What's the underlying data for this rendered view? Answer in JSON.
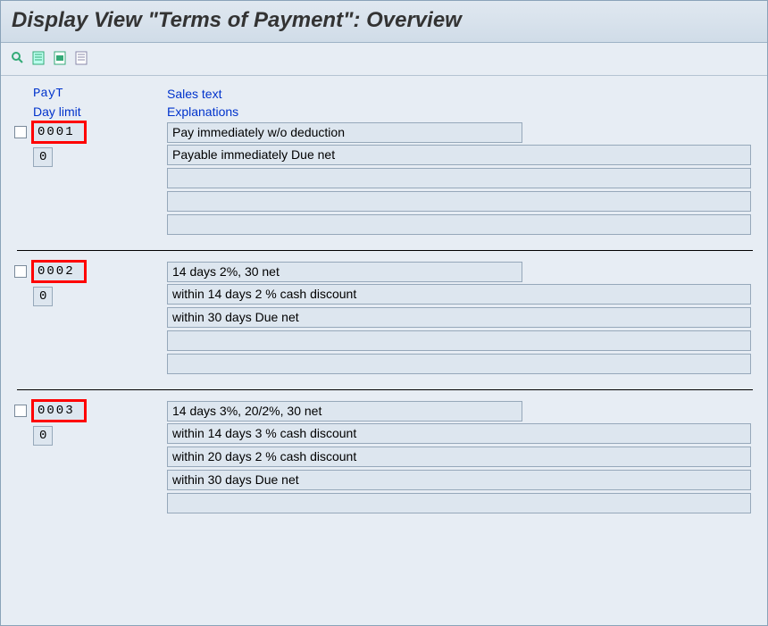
{
  "title": "Display View \"Terms of Payment\": Overview",
  "headers": {
    "payt": "PayT",
    "daylimit": "Day limit",
    "salestext": "Sales text",
    "explanations": "Explanations"
  },
  "entries": [
    {
      "payt": "0001",
      "daylimit": "0",
      "salestext": "Pay immediately w/o deduction",
      "explain1": "Payable immediately Due net",
      "explain2": "",
      "explain3": "",
      "explain4": ""
    },
    {
      "payt": "0002",
      "daylimit": "0",
      "salestext": "14 days 2%, 30 net",
      "explain1": "within 14 days 2 % cash discount",
      "explain2": "within 30 days Due net",
      "explain3": "",
      "explain4": ""
    },
    {
      "payt": "0003",
      "daylimit": "0",
      "salestext": "14 days 3%, 20/2%, 30 net",
      "explain1": "within 14 days 3 % cash discount",
      "explain2": "within 20 days 2 % cash discount",
      "explain3": "within 30 days Due net",
      "explain4": ""
    }
  ]
}
